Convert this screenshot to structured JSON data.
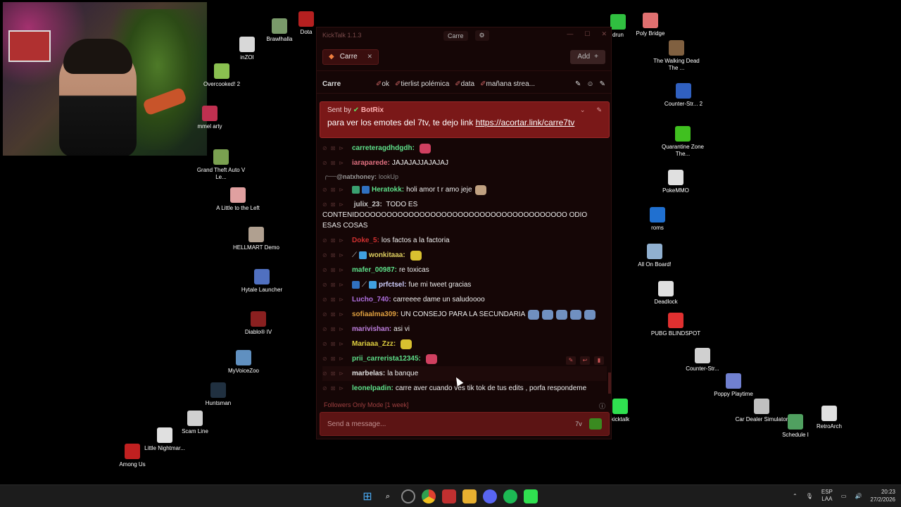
{
  "desktop": {
    "icons": [
      {
        "id": "brawlhalla",
        "label": "Brawlhalla",
        "color": "#7a9a6a"
      },
      {
        "id": "dota",
        "label": "Dota",
        "color": "#b52020"
      },
      {
        "id": "inzoi",
        "label": "inZOI",
        "color": "#d8d8d8"
      },
      {
        "id": "overcooked",
        "label": "Overcooked! 2",
        "color": "#8ac050"
      },
      {
        "id": "rummel",
        "label": "mmel arty",
        "color": "#c03050"
      },
      {
        "id": "gta",
        "label": "Grand Theft Auto V Le...",
        "color": "#7aa050"
      },
      {
        "id": "little-left",
        "label": "A Little to the Left",
        "color": "#e0a0a0"
      },
      {
        "id": "hellmart",
        "label": "HELLMART Demo",
        "color": "#b0a090"
      },
      {
        "id": "hytale",
        "label": "Hytale Launcher",
        "color": "#5070c0"
      },
      {
        "id": "diablo",
        "label": "Diablo® IV",
        "color": "#8a2020"
      },
      {
        "id": "myvoicezoo",
        "label": "MyVoiceZoo",
        "color": "#6090c0"
      },
      {
        "id": "huntsman",
        "label": "Huntsman",
        "color": "#203040"
      },
      {
        "id": "scamline",
        "label": "Scam Line",
        "color": "#d0d0d0"
      },
      {
        "id": "littlenightmares",
        "label": "Little Nightmar...",
        "color": "#e0e0e0"
      },
      {
        "id": "amongus",
        "label": "Among Us",
        "color": "#c02020"
      },
      {
        "id": "drun",
        "label": "drun",
        "color": "#30c040"
      },
      {
        "id": "polybridge",
        "label": "Poly Bridge",
        "color": "#e07070"
      },
      {
        "id": "walkingdead",
        "label": "The Walking Dead The ...",
        "color": "#806040"
      },
      {
        "id": "cs2",
        "label": "Counter-Str... 2",
        "color": "#3060c0"
      },
      {
        "id": "quarantine",
        "label": "Quarantine Zone The...",
        "color": "#40c020"
      },
      {
        "id": "pokemmo",
        "label": "PokeMMO",
        "color": "#e0e0e0"
      },
      {
        "id": "roms",
        "label": "roms",
        "color": "#2070d0"
      },
      {
        "id": "allonboard",
        "label": "All On Board!",
        "color": "#90b0d0"
      },
      {
        "id": "deadlock",
        "label": "Deadlock",
        "color": "#e0e0e0"
      },
      {
        "id": "pubg",
        "label": "PUBG BLINDSPOT",
        "color": "#e03030"
      },
      {
        "id": "counterstrike",
        "label": "Counter-Str...",
        "color": "#d0d0d0"
      },
      {
        "id": "poppy",
        "label": "Poppy Playtime",
        "color": "#7080d0"
      },
      {
        "id": "kicktalk-icon",
        "label": "kicktalk",
        "color": "#30e050"
      },
      {
        "id": "cardealer",
        "label": "Car Dealer Simulator",
        "color": "#c0c0c0"
      },
      {
        "id": "schedule",
        "label": "Schedule I",
        "color": "#50a060"
      },
      {
        "id": "retroarch",
        "label": "RetroArch",
        "color": "#e0e0e0"
      }
    ]
  },
  "kicktalk": {
    "title": "KickTalk 1.1.3",
    "title_channel": "Carre",
    "settings_icon": "gear-icon",
    "tab_label": "Carre",
    "add_label": "Add",
    "channel_name": "Carre",
    "pinned_streams": [
      "ok",
      "tierlist polémica",
      "data",
      "mañana strea..."
    ],
    "pinned": {
      "sent_by_prefix": "Sent by",
      "sender": "BotRix",
      "text": "para ver los emotes del 7tv, te dejo link ",
      "link": "https://acortar.link/carre7tv"
    },
    "messages": [
      {
        "user": "carreteragdhdgdh:",
        "text": "",
        "user_color": "#5ee08a",
        "emote": "#d04060"
      },
      {
        "user": "iaraparede:",
        "text": "JAJAJAJJAJAJAJ",
        "user_color": "#e07080"
      },
      {
        "reply_user": "@natxhoney:",
        "reply_text": "lookUp"
      },
      {
        "user": "Heratokk:",
        "text": "holi amor t r amo jeje",
        "user_color": "#5ee08a",
        "emote": "#c0a080"
      },
      {
        "user": "julix_23:",
        "text": "TODO ES CONTENIDOOOOOOOOOOOOOOOOOOOOOOOOOOOOOOOOOOOOOO ODIO ESAS COSAS",
        "user_color": "#cccccc"
      },
      {
        "user": "Doke_5:",
        "text": "los factos a la factoria",
        "user_color": "#d03030"
      },
      {
        "user": "wonkitaaa:",
        "text": "",
        "user_color": "#e0d060",
        "emote": "#d8c030"
      },
      {
        "user": "mafer_00987:",
        "text": "re toxicas",
        "user_color": "#5ee08a"
      },
      {
        "user": "prfctsel:",
        "text": "fue mi tweet gracias",
        "user_color": "#d0d0ff"
      },
      {
        "user": "Lucho_740:",
        "text": "carreeee dame un saludoooo",
        "user_color": "#b070e0"
      },
      {
        "user": "sofiaalma309:",
        "text": "UN CONSEJO PARA LA SECUNDARIA",
        "user_color": "#e0a040",
        "emote": "#7090c0"
      },
      {
        "user": "marivishan:",
        "text": "asi vi",
        "user_color": "#c080e0"
      },
      {
        "user": "Mariaaa_Zzz:",
        "text": "",
        "user_color": "#e0d040",
        "emote": "#d8c030"
      },
      {
        "user": "prii_carrerista12345:",
        "text": "",
        "user_color": "#5ee08a",
        "emote": "#d04060"
      },
      {
        "user": "marbelas:",
        "text": "la banque",
        "user_color": "#e0e0e0"
      },
      {
        "user": "leonelpadin:",
        "text": "carre aver cuando ves tik tok de tus edits , porfa respondeme",
        "user_color": "#5ee08a"
      }
    ],
    "footer_mode": "Followers Only Mode [1 week]",
    "input_placeholder": "Send a message..."
  },
  "taskbar": {
    "apps": [
      "windows-start",
      "search",
      "chrome-alt",
      "chrome",
      "media",
      "files",
      "discord",
      "spotify",
      "kick"
    ],
    "lang_top": "ESP",
    "lang_bottom": "LAA",
    "time": "20:23",
    "date": "27/2/2026"
  }
}
